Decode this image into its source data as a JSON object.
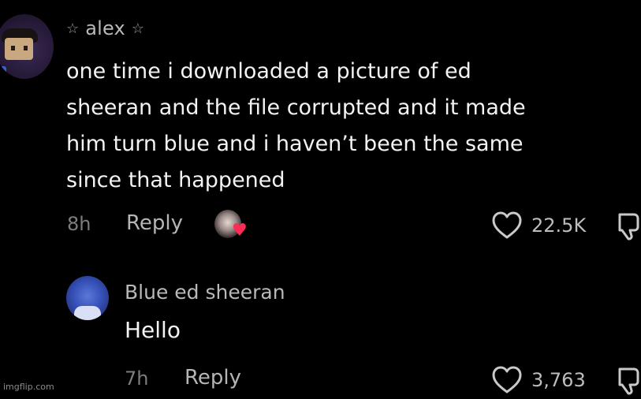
{
  "comment": {
    "username": "alex",
    "star_left": "☆",
    "star_right": "☆",
    "text": "one time i downloaded a picture of ed\nsheeran and the file corrupted and it made\nhim turn blue and i haven’t been the same\nsince that happened",
    "time": "8h",
    "reply_label": "Reply",
    "likes": "22.5K",
    "creator_liked": true,
    "avatar_icon": "pixel-character-avatar",
    "creator_icon": "creator-avatar-with-heart",
    "like_icon": "heart-outline-icon",
    "dislike_icon": "thumbs-down-icon"
  },
  "reply": {
    "username": "Blue ed sheeran",
    "text": "Hello",
    "time": "7h",
    "reply_label": "Reply",
    "likes": "3,763",
    "avatar_icon": "blue-photo-avatar",
    "like_icon": "heart-outline-icon",
    "dislike_icon": "thumbs-down-icon"
  },
  "watermark": "imgflip.com",
  "colors": {
    "background": "#000000",
    "primary_text": "#f3f3f3",
    "secondary_text": "#b9b9b9",
    "muted_text": "#7d7d7d",
    "heart_accent": "#fe2c55",
    "reply_avatar_blue": "#3550b8"
  }
}
